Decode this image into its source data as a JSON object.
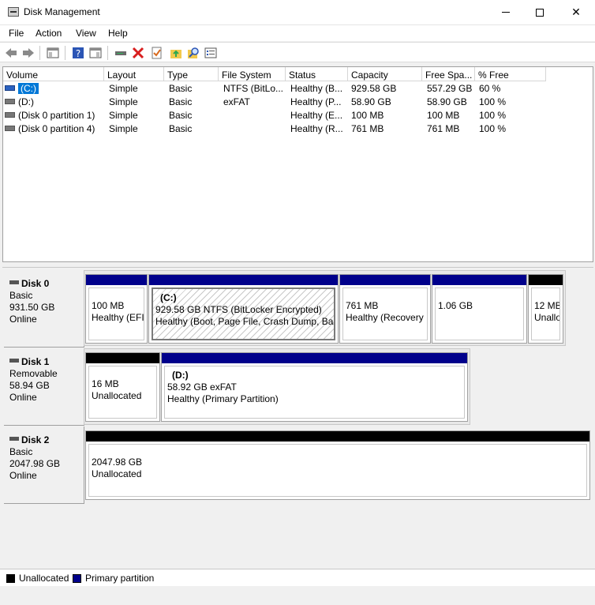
{
  "window": {
    "title": "Disk Management"
  },
  "menu": [
    "File",
    "Action",
    "View",
    "Help"
  ],
  "toolbar": {
    "icons": [
      "back-arrow-icon",
      "forward-arrow-icon",
      "console-tree-icon",
      "help-icon",
      "properties-pane-icon",
      "connect-drive-icon",
      "delete-icon",
      "check-icon",
      "folder-up-icon",
      "search-icon",
      "list-view-icon"
    ]
  },
  "volume_list": {
    "columns": [
      "Volume",
      "Layout",
      "Type",
      "File System",
      "Status",
      "Capacity",
      "Free Spa...",
      "% Free"
    ],
    "rows": [
      {
        "volume": "(C:)",
        "layout": "Simple",
        "type": "Basic",
        "fs": "NTFS (BitLo...",
        "status": "Healthy (B...",
        "capacity": "929.58 GB",
        "free": "557.29 GB",
        "pct": "60 %",
        "selected": true
      },
      {
        "volume": "(D:)",
        "layout": "Simple",
        "type": "Basic",
        "fs": "exFAT",
        "status": "Healthy (P...",
        "capacity": "58.90 GB",
        "free": "58.90 GB",
        "pct": "100 %"
      },
      {
        "volume": "(Disk 0 partition 1)",
        "layout": "Simple",
        "type": "Basic",
        "fs": "",
        "status": "Healthy (E...",
        "capacity": "100 MB",
        "free": "100 MB",
        "pct": "100 %"
      },
      {
        "volume": "(Disk 0 partition 4)",
        "layout": "Simple",
        "type": "Basic",
        "fs": "",
        "status": "Healthy (R...",
        "capacity": "761 MB",
        "free": "761 MB",
        "pct": "100 %"
      }
    ]
  },
  "disks": [
    {
      "name": "Disk 0",
      "type": "Basic",
      "size": "931.50 GB",
      "state": "Online",
      "partitions": [
        {
          "label": "",
          "line1": "100 MB",
          "line2": "Healthy (EFI"
        },
        {
          "label": "(C:)",
          "line1": "929.58 GB NTFS (BitLocker Encrypted)",
          "line2": "Healthy (Boot, Page File, Crash Dump, Basi"
        },
        {
          "label": "",
          "line1": "761 MB",
          "line2": "Healthy (Recovery"
        },
        {
          "label": "",
          "line1": "1.06 GB",
          "line2": ""
        },
        {
          "label": "",
          "line1": "12 MB",
          "line2": "Unallocated"
        }
      ]
    },
    {
      "name": "Disk 1",
      "type": "Removable",
      "size": "58.94 GB",
      "state": "Online",
      "partitions": [
        {
          "label": "",
          "line1": "16 MB",
          "line2": "Unallocated"
        },
        {
          "label": "(D:)",
          "line1": "58.92 GB exFAT",
          "line2": "Healthy (Primary Partition)"
        }
      ]
    },
    {
      "name": "Disk 2",
      "type": "Basic",
      "size": "2047.98 GB",
      "state": "Online",
      "partitions": [
        {
          "label": "",
          "line1": "2047.98 GB",
          "line2": "Unallocated"
        }
      ]
    }
  ],
  "legend": [
    {
      "label": "Unallocated",
      "color": "#000000"
    },
    {
      "label": "Primary partition",
      "color": "#00008b"
    }
  ]
}
